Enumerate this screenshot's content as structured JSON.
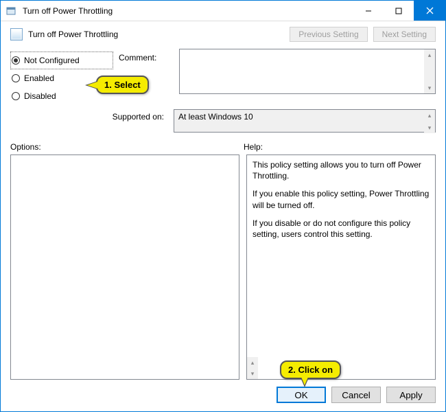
{
  "window": {
    "title": "Turn off Power Throttling"
  },
  "header": {
    "subtitle": "Turn off Power Throttling",
    "previous_label": "Previous Setting",
    "next_label": "Next Setting"
  },
  "radios": {
    "not_configured": "Not Configured",
    "enabled": "Enabled",
    "disabled": "Disabled",
    "selected": "not_configured"
  },
  "comment": {
    "label": "Comment:",
    "value": ""
  },
  "supported": {
    "label": "Supported on:",
    "value": "At least Windows 10"
  },
  "sections": {
    "options_label": "Options:",
    "help_label": "Help:"
  },
  "help": {
    "p1": "This policy setting allows you to turn off Power Throttling.",
    "p2": "If you enable this policy setting, Power Throttling will be turned off.",
    "p3": "If you disable or do not configure this policy setting, users control this setting."
  },
  "buttons": {
    "ok": "OK",
    "cancel": "Cancel",
    "apply": "Apply"
  },
  "callouts": {
    "c1": "1. Select",
    "c2": "2. Click on"
  }
}
